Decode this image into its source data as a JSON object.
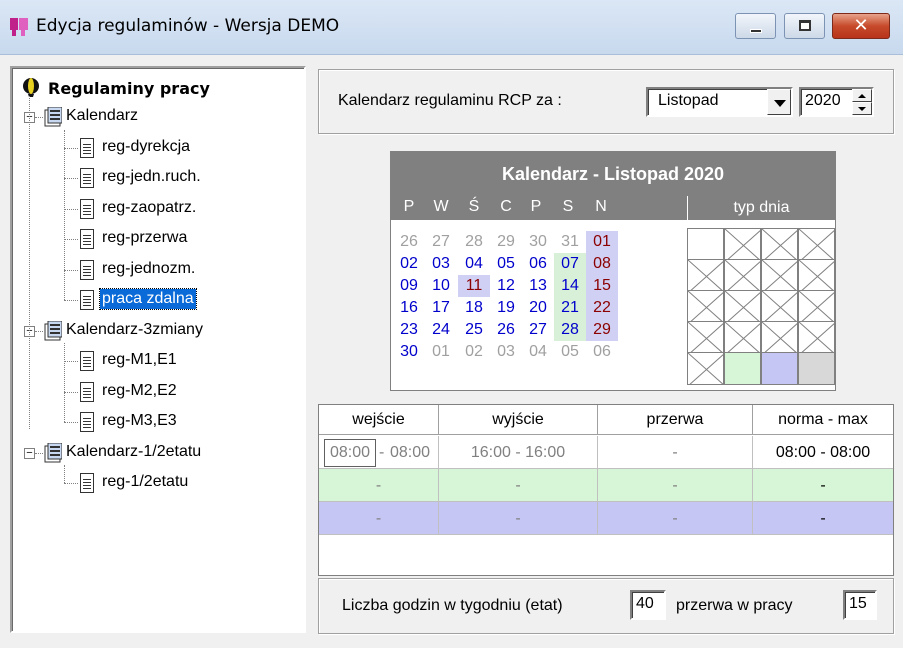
{
  "window": {
    "title": "Edycja regulaminów - Wersja DEMO"
  },
  "tree": {
    "root": "Regulaminy pracy",
    "groups": [
      {
        "label": "Kalendarz",
        "items": [
          "reg-dyrekcja",
          "reg-jedn.ruch.",
          "reg-zaopatrz.",
          "reg-przerwa",
          "reg-jednozm.",
          "praca zdalna"
        ]
      },
      {
        "label": "Kalendarz-3zmiany",
        "items": [
          "reg-M1,E1",
          "reg-M2,E2",
          "reg-M3,E3"
        ]
      },
      {
        "label": "Kalendarz-1/2etatu",
        "items": [
          "reg-1/2etatu"
        ]
      }
    ],
    "selected": "praca zdalna"
  },
  "calendar_selector": {
    "caption": "Kalendarz regulaminu RCP  za :",
    "month": "Listopad",
    "year": "2020"
  },
  "calendar": {
    "title": "Kalendarz - Listopad 2020",
    "day_headers": [
      "P",
      "W",
      "Ś",
      "C",
      "P",
      "S",
      "N"
    ],
    "type_header": "typ dnia",
    "weeks": [
      [
        "26",
        "27",
        "28",
        "29",
        "30",
        "31",
        "01"
      ],
      [
        "02",
        "03",
        "04",
        "05",
        "06",
        "07",
        "08"
      ],
      [
        "09",
        "10",
        "11",
        "12",
        "13",
        "14",
        "15"
      ],
      [
        "16",
        "17",
        "18",
        "19",
        "20",
        "21",
        "22"
      ],
      [
        "23",
        "24",
        "25",
        "26",
        "27",
        "28",
        "29"
      ],
      [
        "30",
        "01",
        "02",
        "03",
        "04",
        "05",
        "06"
      ]
    ]
  },
  "schedule": {
    "headers": [
      "wejście",
      "wyjście",
      "przerwa",
      "norma - max"
    ],
    "rows": [
      {
        "wejscie_from": "08:00",
        "wejscie_to": "08:00",
        "wyjscie": "16:00 - 16:00",
        "przerwa": "-",
        "norma": "08:00 - 08:00"
      },
      {
        "wejscie": "-",
        "wyjscie": "-",
        "przerwa": "-",
        "norma": "-"
      },
      {
        "wejscie": "-",
        "wyjscie": "-",
        "przerwa": "-",
        "norma": "-"
      }
    ]
  },
  "footer": {
    "hours_label": "Liczba godzin w tygodniu (etat)",
    "hours_value": "40",
    "break_label": "przerwa w pracy",
    "break_value": "15"
  },
  "colors": {
    "selection": "#0a6ad8",
    "sunday": "#8b0000",
    "weekday": "#0000cc",
    "green_row": "#d7f5d7",
    "blue_row": "#c6c6f5"
  }
}
